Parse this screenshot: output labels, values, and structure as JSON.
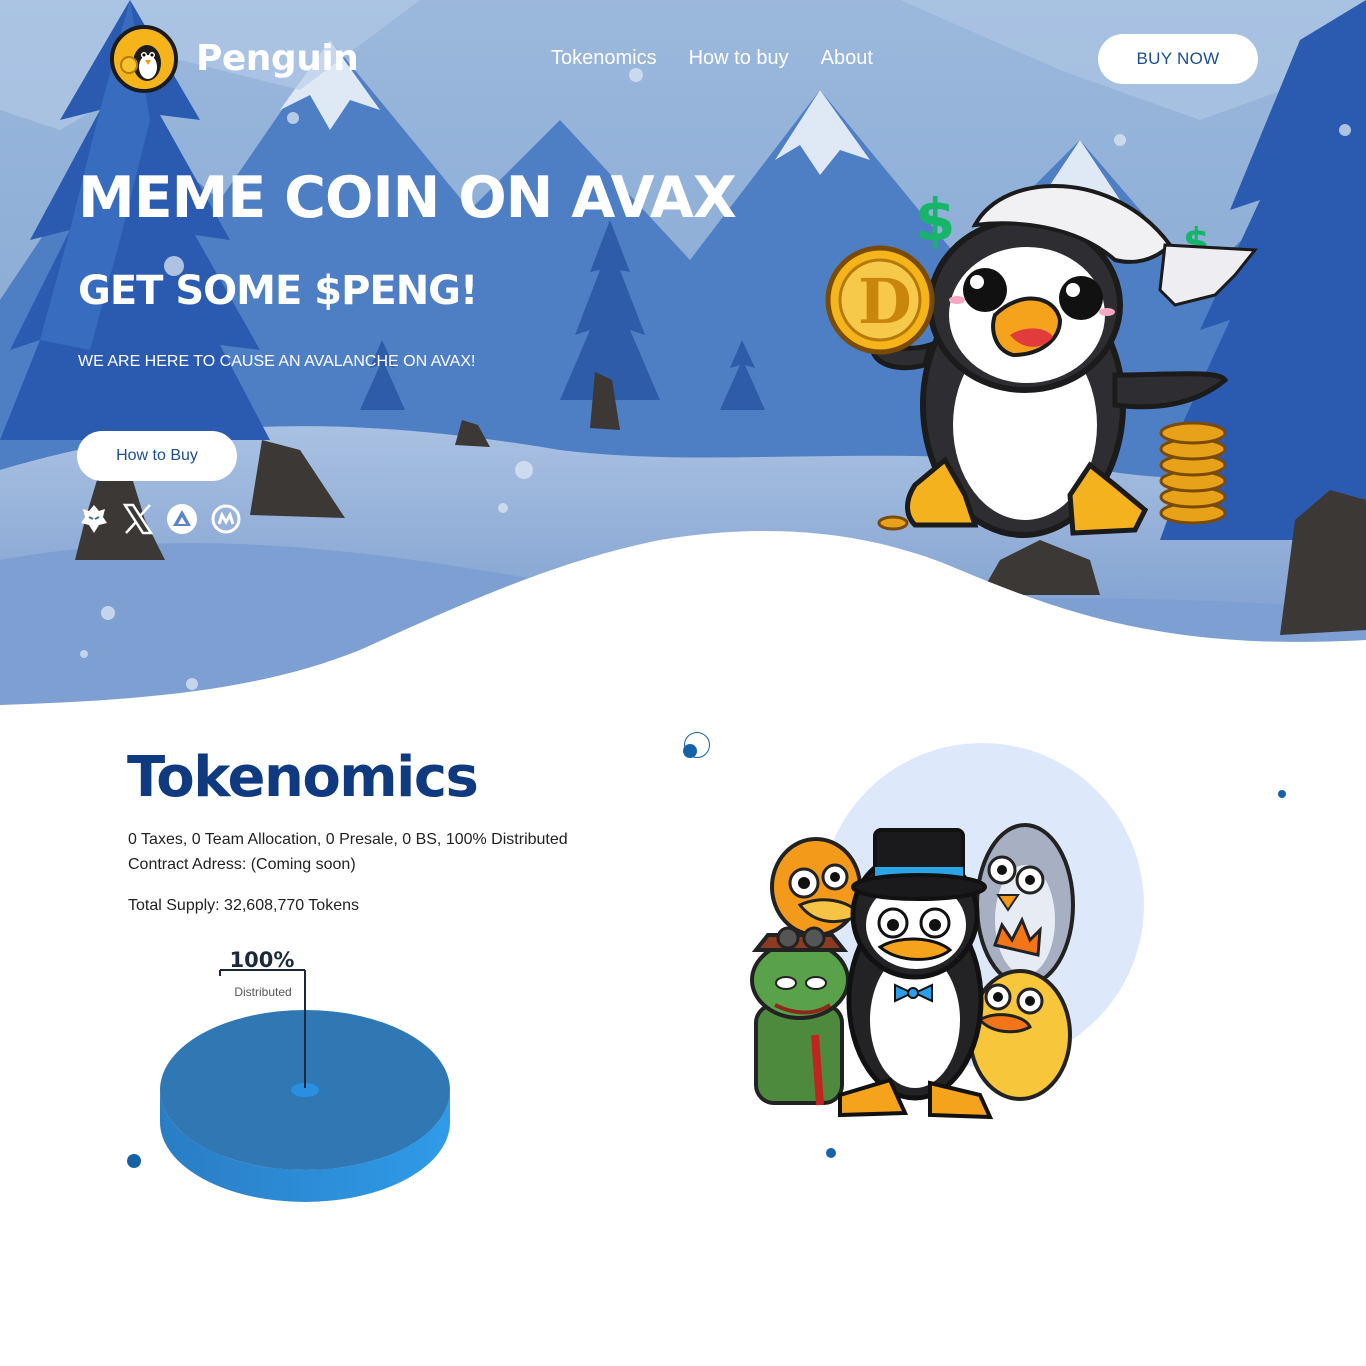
{
  "nav": {
    "brand": "Penguin",
    "links": [
      "Tokenomics",
      "How to buy",
      "About"
    ],
    "buy_now": "BUY NOW"
  },
  "hero": {
    "title": "MEME COIN ON AVAX",
    "subtitle": "GET SOME $PENG!",
    "tagline": "WE ARE HERE TO CAUSE AN AVALANCHE ON AVAX!",
    "cta": "How to Buy",
    "socials": [
      "dexscreener-icon",
      "x-icon",
      "avalanche-icon",
      "coinmarketcap-icon"
    ]
  },
  "tokenomics": {
    "title": "Tokenomics",
    "line1": "0 Taxes, 0 Team Allocation, 0 Presale, 0 BS, 100% Distributed",
    "line2": "Contract Adress: (Coming soon)",
    "supply": "Total Supply: 32,608,770 Tokens",
    "chart_percent": "100%",
    "chart_label": "Distributed"
  },
  "colors": {
    "hero_sky": "#8fb0d8",
    "hero_deep": "#3d6db4",
    "heading": "#0f3a80",
    "button_text": "#1c4f8c",
    "pie": "#2b7bc0",
    "accent_dot": "#1662a8"
  },
  "chart_data": {
    "type": "pie",
    "categories": [
      "Distributed"
    ],
    "values": [
      100
    ],
    "labels": [
      "100%"
    ]
  }
}
